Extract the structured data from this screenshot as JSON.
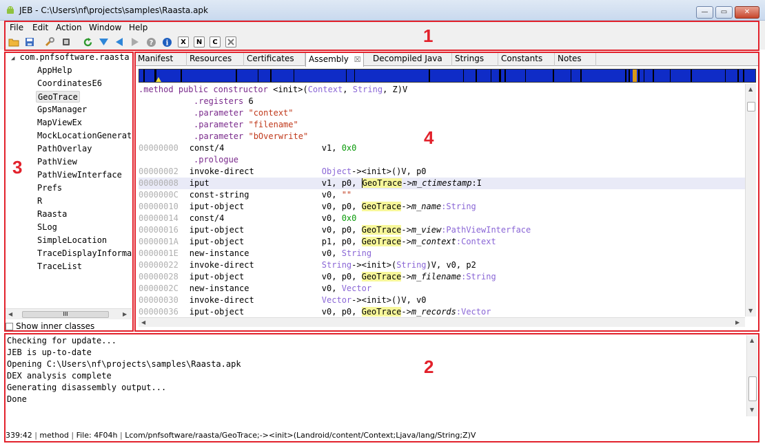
{
  "window": {
    "title": "JEB - C:\\Users\\nf\\projects\\samples\\Raasta.apk",
    "minimize": "—",
    "maximize": "▭",
    "close": "✕"
  },
  "menu": [
    "File",
    "Edit",
    "Action",
    "Window",
    "Help"
  ],
  "toolbar": {
    "icons": [
      "open-folder-icon",
      "save-icon",
      "wrench-icon",
      "chip-icon",
      "refresh-icon",
      "down-arrow-icon",
      "back-arrow-icon",
      "forward-arrow-icon",
      "help-icon",
      "info-icon",
      "x-icon",
      "n-icon",
      "c-icon",
      "cross-icon"
    ],
    "x_label": "X",
    "n_label": "N",
    "c_label": "C"
  },
  "annotations": [
    "1",
    "2",
    "3",
    "4"
  ],
  "tree": {
    "root": "com.pnfsoftware.raasta",
    "items": [
      "AppHelp",
      "CoordinatesE6",
      "GeoTrace",
      "GpsManager",
      "MapViewEx",
      "MockLocationGenerator",
      "PathOverlay",
      "PathView",
      "PathViewInterface",
      "Prefs",
      "R",
      "Raasta",
      "SLog",
      "SimpleLocation",
      "TraceDisplayInformation",
      "TraceList"
    ],
    "selected": "GeoTrace",
    "show_inner_label": "Show inner classes",
    "scroll_grip": "III"
  },
  "tabs": [
    {
      "label": "Manifest",
      "active": false
    },
    {
      "label": "Resources",
      "active": false
    },
    {
      "label": "Certificates",
      "active": false
    },
    {
      "label": "Assembly",
      "active": true
    },
    {
      "label": "Decompiled Java",
      "active": false
    },
    {
      "label": "Strings",
      "active": false
    },
    {
      "label": "Constants",
      "active": false
    },
    {
      "label": "Notes",
      "active": false
    }
  ],
  "tab_close_glyph": "☒",
  "code": {
    "header": {
      "method_kw": ".method",
      "public_kw": "public",
      "constructor_kw": "constructor",
      "init": "<init>(",
      "type1": "Context",
      "sep": ", ",
      "type2": "String",
      "rest": ", Z)V"
    },
    "registers": {
      "kw": ".registers",
      "value": "6"
    },
    "parameters": [
      {
        "kw": ".parameter",
        "value": "\"context\""
      },
      {
        "kw": ".parameter",
        "value": "\"filename\""
      },
      {
        "kw": ".parameter",
        "value": "\"bOverwrite\""
      }
    ],
    "prologue": ".prologue",
    "instructions": [
      {
        "addr": "00000000",
        "op": "const/4",
        "args": "v1, ",
        "num": "0x0"
      },
      {
        "addr": "00000002",
        "op": "invoke-direct",
        "type": "Object",
        "rest": "-><init>()V, p0"
      },
      {
        "addr": "00000008",
        "op": "iput",
        "args": "v1, p0, ",
        "cls": "GeoTrace",
        "arrow": "->",
        "field": "m_ctimestamp",
        "ftype": ":I"
      },
      {
        "addr": "0000000C",
        "op": "const-string",
        "args": "v0, ",
        "str": "\"\""
      },
      {
        "addr": "00000010",
        "op": "iput-object",
        "args": "v0, p0, ",
        "cls": "GeoTrace",
        "arrow": "->",
        "field": "m_name",
        "ftype": ":String"
      },
      {
        "addr": "00000014",
        "op": "const/4",
        "args": "v0, ",
        "num": "0x0"
      },
      {
        "addr": "00000016",
        "op": "iput-object",
        "args": "v0, p0, ",
        "cls": "GeoTrace",
        "arrow": "->",
        "field": "m_view",
        "ftype": ":PathViewInterface"
      },
      {
        "addr": "0000001A",
        "op": "iput-object",
        "args": "p1, p0, ",
        "cls": "GeoTrace",
        "arrow": "->",
        "field": "m_context",
        "ftype": ":Context"
      },
      {
        "addr": "0000001E",
        "op": "new-instance",
        "args": "v0, ",
        "type": "String"
      },
      {
        "addr": "00000022",
        "op": "invoke-direct",
        "type": "String",
        "rest": "-><init>(",
        "type2": "String",
        "rest2": ")V, v0, p2"
      },
      {
        "addr": "00000028",
        "op": "iput-object",
        "args": "v0, p0, ",
        "cls": "GeoTrace",
        "arrow": "->",
        "field": "m_filename",
        "ftype": ":String"
      },
      {
        "addr": "0000002C",
        "op": "new-instance",
        "args": "v0, ",
        "type": "Vector"
      },
      {
        "addr": "00000030",
        "op": "invoke-direct",
        "type": "Vector",
        "rest": "-><init>()V, v0"
      },
      {
        "addr": "00000036",
        "op": "iput-object",
        "args": "v0, p0, ",
        "cls": "GeoTrace",
        "arrow": "->",
        "field": "m_records",
        "ftype": ":Vector"
      }
    ]
  },
  "console": {
    "lines": [
      "Checking for update...",
      "JEB is up-to-date",
      "Opening C:\\Users\\nf\\projects\\samples\\Raasta.apk",
      "DEX analysis complete",
      "Generating disassembly output...",
      "Done"
    ]
  },
  "status": {
    "position": "339:42",
    "kind": "method",
    "file": "File: 4F04h",
    "signature": "Lcom/pnfsoftware/raasta/GeoTrace;-><init>(Landroid/content/Context;Ljava/lang/String;Z)V"
  },
  "colors": {
    "annotation_red": "#e2212b",
    "overview_blue": "#0f2cc7",
    "highlight_yellow": "#f7f79a",
    "type_purple": "#8a66d6",
    "string_red": "#c0391b",
    "number_green": "#0a9a0a"
  }
}
